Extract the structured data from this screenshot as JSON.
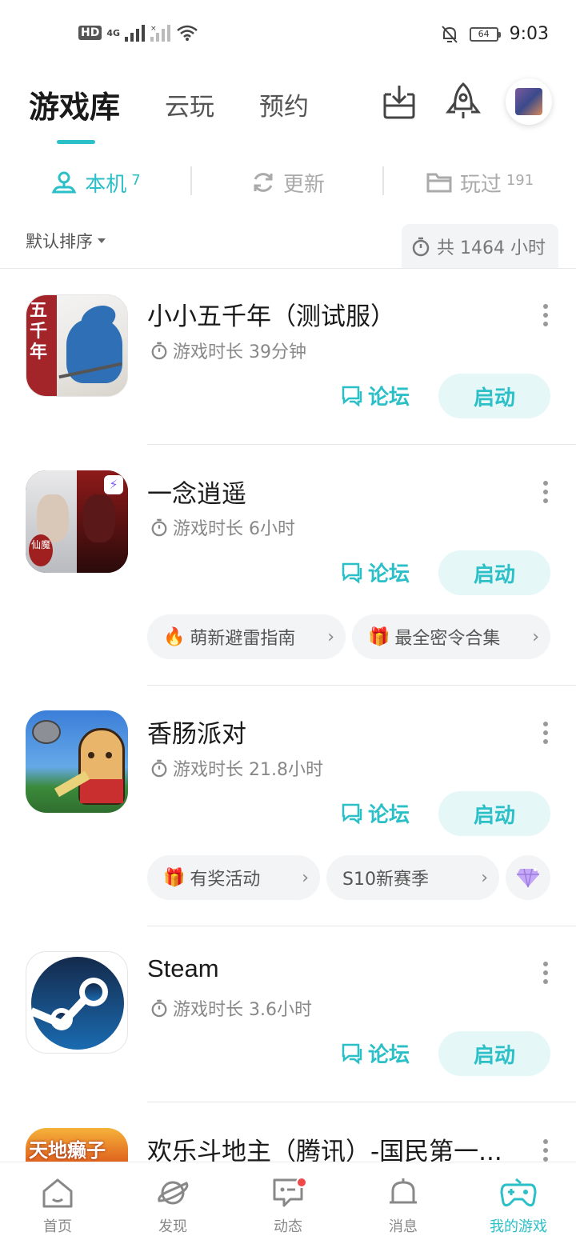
{
  "status_bar": {
    "hd": "HD",
    "network": "4G",
    "battery": "64",
    "time": "9:03"
  },
  "header": {
    "tabs": [
      {
        "label": "游戏库"
      },
      {
        "label": "云玩"
      },
      {
        "label": "预约"
      }
    ]
  },
  "sub_tabs": [
    {
      "label": "本机",
      "count": "7"
    },
    {
      "label": "更新",
      "count": ""
    },
    {
      "label": "玩过",
      "count": "191"
    }
  ],
  "sort": {
    "label": "默认排序",
    "total_time": "共 1464 小时"
  },
  "games": [
    {
      "title": "小小五千年（测试服）",
      "play_time": "游戏时长 39分钟",
      "forum": "论坛",
      "launch": "启动",
      "chips": []
    },
    {
      "title": "一念逍遥",
      "play_time": "游戏时长 6小时",
      "forum": "论坛",
      "launch": "启动",
      "chips": [
        {
          "icon": "🔥",
          "label": "萌新避雷指南"
        },
        {
          "icon": "🎁",
          "label": "最全密令合集"
        }
      ]
    },
    {
      "title": "香肠派对",
      "play_time": "游戏时长 21.8小时",
      "forum": "论坛",
      "launch": "启动",
      "chips": [
        {
          "icon": "🎁",
          "label": "有奖活动"
        },
        {
          "icon": "",
          "label": "S10新赛季"
        }
      ]
    },
    {
      "title": "Steam",
      "play_time": "游戏时长 3.6小时",
      "forum": "论坛",
      "launch": "启动",
      "chips": []
    },
    {
      "title": "欢乐斗地主（腾讯）-国民第一...",
      "play_time": "",
      "forum": "",
      "launch": "",
      "chips": []
    }
  ],
  "icon_texts": {
    "game1": "五千年",
    "game2_badge": "仙魔",
    "game5": "天地癞子"
  },
  "bottom_nav": [
    {
      "label": "首页",
      "icon": "home-icon"
    },
    {
      "label": "发现",
      "icon": "planet-icon"
    },
    {
      "label": "动态",
      "icon": "chat-icon"
    },
    {
      "label": "消息",
      "icon": "bell-icon"
    },
    {
      "label": "我的游戏",
      "icon": "gamepad-icon"
    }
  ],
  "colors": {
    "accent": "#2bbfc7",
    "accent_bg": "#e6f7f8",
    "badge": "#f04848"
  }
}
